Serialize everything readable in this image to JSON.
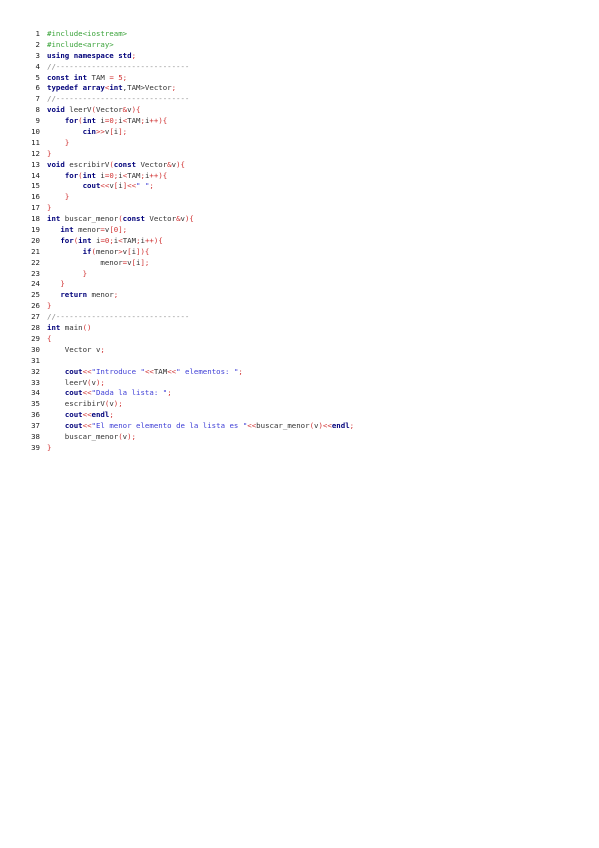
{
  "document": {
    "lines": [
      {
        "n": "1",
        "tokens": [
          {
            "t": "#include<iostream>",
            "c": "pp"
          }
        ]
      },
      {
        "n": "2",
        "tokens": [
          {
            "t": "#include<array>",
            "c": "pp"
          }
        ]
      },
      {
        "n": "3",
        "tokens": [
          {
            "t": "using",
            "c": "kw"
          },
          {
            "t": " ",
            "c": "tx"
          },
          {
            "t": "namespace",
            "c": "kw"
          },
          {
            "t": " ",
            "c": "tx"
          },
          {
            "t": "std",
            "c": "kw"
          },
          {
            "t": ";",
            "c": "pn"
          }
        ]
      },
      {
        "n": "4",
        "tokens": [
          {
            "t": "//------------------------------",
            "c": "cm"
          }
        ]
      },
      {
        "n": "5",
        "tokens": [
          {
            "t": "const",
            "c": "kw"
          },
          {
            "t": " ",
            "c": "tx"
          },
          {
            "t": "int",
            "c": "kw"
          },
          {
            "t": " TAM ",
            "c": "tx"
          },
          {
            "t": "=",
            "c": "pn"
          },
          {
            "t": " ",
            "c": "tx"
          },
          {
            "t": "5",
            "c": "num"
          },
          {
            "t": ";",
            "c": "pn"
          }
        ]
      },
      {
        "n": "6",
        "tokens": [
          {
            "t": "typedef",
            "c": "kw"
          },
          {
            "t": " ",
            "c": "tx"
          },
          {
            "t": "array",
            "c": "kw"
          },
          {
            "t": "<",
            "c": "pn"
          },
          {
            "t": "int",
            "c": "kw"
          },
          {
            "t": ",TAM>Vector",
            "c": "tx"
          },
          {
            "t": ";",
            "c": "pn"
          }
        ]
      },
      {
        "n": "7",
        "tokens": [
          {
            "t": "//------------------------------",
            "c": "cm"
          }
        ]
      },
      {
        "n": "8",
        "tokens": [
          {
            "t": "void",
            "c": "kw"
          },
          {
            "t": " leerV",
            "c": "tx"
          },
          {
            "t": "(",
            "c": "pn"
          },
          {
            "t": "Vector",
            "c": "tx"
          },
          {
            "t": "&",
            "c": "pn"
          },
          {
            "t": "v",
            "c": "tx"
          },
          {
            "t": "){",
            "c": "pn"
          }
        ]
      },
      {
        "n": "9",
        "tokens": [
          {
            "t": "    ",
            "c": "tx"
          },
          {
            "t": "for",
            "c": "kw"
          },
          {
            "t": "(",
            "c": "pn"
          },
          {
            "t": "int",
            "c": "kw"
          },
          {
            "t": " i",
            "c": "tx"
          },
          {
            "t": "=",
            "c": "pn"
          },
          {
            "t": "0",
            "c": "num"
          },
          {
            "t": ";",
            "c": "pn"
          },
          {
            "t": "i",
            "c": "tx"
          },
          {
            "t": "<",
            "c": "pn"
          },
          {
            "t": "TAM",
            "c": "tx"
          },
          {
            "t": ";",
            "c": "pn"
          },
          {
            "t": "i",
            "c": "tx"
          },
          {
            "t": "++){",
            "c": "pn"
          }
        ]
      },
      {
        "n": "10",
        "tokens": [
          {
            "t": "        ",
            "c": "tx"
          },
          {
            "t": "cin",
            "c": "kw"
          },
          {
            "t": ">>",
            "c": "pn"
          },
          {
            "t": "v",
            "c": "tx"
          },
          {
            "t": "[",
            "c": "pn"
          },
          {
            "t": "i",
            "c": "tx"
          },
          {
            "t": "];",
            "c": "pn"
          }
        ]
      },
      {
        "n": "11",
        "tokens": [
          {
            "t": "    ",
            "c": "tx"
          },
          {
            "t": "}",
            "c": "pn"
          }
        ]
      },
      {
        "n": "12",
        "tokens": [
          {
            "t": "}",
            "c": "pn"
          }
        ]
      },
      {
        "n": "13",
        "tokens": [
          {
            "t": "void",
            "c": "kw"
          },
          {
            "t": " escribirV",
            "c": "tx"
          },
          {
            "t": "(",
            "c": "pn"
          },
          {
            "t": "const",
            "c": "kw"
          },
          {
            "t": " Vector",
            "c": "tx"
          },
          {
            "t": "&",
            "c": "pn"
          },
          {
            "t": "v",
            "c": "tx"
          },
          {
            "t": "){",
            "c": "pn"
          }
        ]
      },
      {
        "n": "14",
        "tokens": [
          {
            "t": "    ",
            "c": "tx"
          },
          {
            "t": "for",
            "c": "kw"
          },
          {
            "t": "(",
            "c": "pn"
          },
          {
            "t": "int",
            "c": "kw"
          },
          {
            "t": " i",
            "c": "tx"
          },
          {
            "t": "=",
            "c": "pn"
          },
          {
            "t": "0",
            "c": "num"
          },
          {
            "t": ";",
            "c": "pn"
          },
          {
            "t": "i",
            "c": "tx"
          },
          {
            "t": "<",
            "c": "pn"
          },
          {
            "t": "TAM",
            "c": "tx"
          },
          {
            "t": ";",
            "c": "pn"
          },
          {
            "t": "i",
            "c": "tx"
          },
          {
            "t": "++){",
            "c": "pn"
          }
        ]
      },
      {
        "n": "15",
        "tokens": [
          {
            "t": "        ",
            "c": "tx"
          },
          {
            "t": "cout",
            "c": "kw"
          },
          {
            "t": "<<",
            "c": "pn"
          },
          {
            "t": "v",
            "c": "tx"
          },
          {
            "t": "[",
            "c": "pn"
          },
          {
            "t": "i",
            "c": "tx"
          },
          {
            "t": "]<<",
            "c": "pn"
          },
          {
            "t": "\" \"",
            "c": "str"
          },
          {
            "t": ";",
            "c": "pn"
          }
        ]
      },
      {
        "n": "16",
        "tokens": [
          {
            "t": "    ",
            "c": "tx"
          },
          {
            "t": "}",
            "c": "pn"
          }
        ]
      },
      {
        "n": "17",
        "tokens": [
          {
            "t": "}",
            "c": "pn"
          }
        ]
      },
      {
        "n": "18",
        "tokens": [
          {
            "t": "int",
            "c": "kw"
          },
          {
            "t": " buscar_menor",
            "c": "tx"
          },
          {
            "t": "(",
            "c": "pn"
          },
          {
            "t": "const",
            "c": "kw"
          },
          {
            "t": " Vector",
            "c": "tx"
          },
          {
            "t": "&",
            "c": "pn"
          },
          {
            "t": "v",
            "c": "tx"
          },
          {
            "t": "){",
            "c": "pn"
          }
        ]
      },
      {
        "n": "19",
        "tokens": [
          {
            "t": "   ",
            "c": "tx"
          },
          {
            "t": "int",
            "c": "kw"
          },
          {
            "t": " menor",
            "c": "tx"
          },
          {
            "t": "=",
            "c": "pn"
          },
          {
            "t": "v",
            "c": "tx"
          },
          {
            "t": "[",
            "c": "pn"
          },
          {
            "t": "0",
            "c": "num"
          },
          {
            "t": "];",
            "c": "pn"
          }
        ]
      },
      {
        "n": "20",
        "tokens": [
          {
            "t": "   ",
            "c": "tx"
          },
          {
            "t": "for",
            "c": "kw"
          },
          {
            "t": "(",
            "c": "pn"
          },
          {
            "t": "int",
            "c": "kw"
          },
          {
            "t": " i",
            "c": "tx"
          },
          {
            "t": "=",
            "c": "pn"
          },
          {
            "t": "0",
            "c": "num"
          },
          {
            "t": ";",
            "c": "pn"
          },
          {
            "t": "i",
            "c": "tx"
          },
          {
            "t": "<",
            "c": "pn"
          },
          {
            "t": "TAM",
            "c": "tx"
          },
          {
            "t": ";",
            "c": "pn"
          },
          {
            "t": "i",
            "c": "tx"
          },
          {
            "t": "++){",
            "c": "pn"
          }
        ]
      },
      {
        "n": "21",
        "tokens": [
          {
            "t": "        ",
            "c": "tx"
          },
          {
            "t": "if",
            "c": "kw"
          },
          {
            "t": "(",
            "c": "pn"
          },
          {
            "t": "menor",
            "c": "tx"
          },
          {
            "t": ">",
            "c": "pn"
          },
          {
            "t": "v",
            "c": "tx"
          },
          {
            "t": "[",
            "c": "pn"
          },
          {
            "t": "i",
            "c": "tx"
          },
          {
            "t": "]){",
            "c": "pn"
          }
        ]
      },
      {
        "n": "22",
        "tokens": [
          {
            "t": "            menor",
            "c": "tx"
          },
          {
            "t": "=",
            "c": "pn"
          },
          {
            "t": "v",
            "c": "tx"
          },
          {
            "t": "[",
            "c": "pn"
          },
          {
            "t": "i",
            "c": "tx"
          },
          {
            "t": "];",
            "c": "pn"
          }
        ]
      },
      {
        "n": "23",
        "tokens": [
          {
            "t": "        ",
            "c": "tx"
          },
          {
            "t": "}",
            "c": "pn"
          }
        ]
      },
      {
        "n": "24",
        "tokens": [
          {
            "t": "   ",
            "c": "tx"
          },
          {
            "t": "}",
            "c": "pn"
          }
        ]
      },
      {
        "n": "25",
        "tokens": [
          {
            "t": "   ",
            "c": "tx"
          },
          {
            "t": "return",
            "c": "kw"
          },
          {
            "t": " menor",
            "c": "tx"
          },
          {
            "t": ";",
            "c": "pn"
          }
        ]
      },
      {
        "n": "26",
        "tokens": [
          {
            "t": "}",
            "c": "pn"
          }
        ]
      },
      {
        "n": "27",
        "tokens": [
          {
            "t": "//------------------------------",
            "c": "cm"
          }
        ]
      },
      {
        "n": "28",
        "tokens": [
          {
            "t": "int",
            "c": "kw"
          },
          {
            "t": " main",
            "c": "tx"
          },
          {
            "t": "()",
            "c": "pn"
          }
        ]
      },
      {
        "n": "29",
        "tokens": [
          {
            "t": "{",
            "c": "pn"
          }
        ]
      },
      {
        "n": "30",
        "tokens": [
          {
            "t": "    Vector v",
            "c": "tx"
          },
          {
            "t": ";",
            "c": "pn"
          }
        ]
      },
      {
        "n": "31",
        "tokens": []
      },
      {
        "n": "32",
        "tokens": [
          {
            "t": "    ",
            "c": "tx"
          },
          {
            "t": "cout",
            "c": "kw"
          },
          {
            "t": "<<",
            "c": "pn"
          },
          {
            "t": "\"Introduce \"",
            "c": "str"
          },
          {
            "t": "<<",
            "c": "pn"
          },
          {
            "t": "TAM",
            "c": "tx"
          },
          {
            "t": "<<",
            "c": "pn"
          },
          {
            "t": "\" elementos: \"",
            "c": "str"
          },
          {
            "t": ";",
            "c": "pn"
          }
        ]
      },
      {
        "n": "33",
        "tokens": [
          {
            "t": "    leerV",
            "c": "tx"
          },
          {
            "t": "(",
            "c": "pn"
          },
          {
            "t": "v",
            "c": "tx"
          },
          {
            "t": ");",
            "c": "pn"
          }
        ]
      },
      {
        "n": "34",
        "tokens": [
          {
            "t": "    ",
            "c": "tx"
          },
          {
            "t": "cout",
            "c": "kw"
          },
          {
            "t": "<<",
            "c": "pn"
          },
          {
            "t": "\"Dada la lista: \"",
            "c": "str"
          },
          {
            "t": ";",
            "c": "pn"
          }
        ]
      },
      {
        "n": "35",
        "tokens": [
          {
            "t": "    escribirV",
            "c": "tx"
          },
          {
            "t": "(",
            "c": "pn"
          },
          {
            "t": "v",
            "c": "tx"
          },
          {
            "t": ");",
            "c": "pn"
          }
        ]
      },
      {
        "n": "36",
        "tokens": [
          {
            "t": "    ",
            "c": "tx"
          },
          {
            "t": "cout",
            "c": "kw"
          },
          {
            "t": "<<",
            "c": "pn"
          },
          {
            "t": "endl",
            "c": "kw"
          },
          {
            "t": ";",
            "c": "pn"
          }
        ]
      },
      {
        "n": "37",
        "tokens": [
          {
            "t": "    ",
            "c": "tx"
          },
          {
            "t": "cout",
            "c": "kw"
          },
          {
            "t": "<<",
            "c": "pn"
          },
          {
            "t": "\"El menor elemento de la lista es \"",
            "c": "str"
          },
          {
            "t": "<<",
            "c": "pn"
          },
          {
            "t": "buscar_menor",
            "c": "tx"
          },
          {
            "t": "(",
            "c": "pn"
          },
          {
            "t": "v",
            "c": "tx"
          },
          {
            "t": ")<<",
            "c": "pn"
          },
          {
            "t": "endl",
            "c": "kw"
          },
          {
            "t": ";",
            "c": "pn"
          }
        ]
      },
      {
        "n": "38",
        "tokens": [
          {
            "t": "    buscar_menor",
            "c": "tx"
          },
          {
            "t": "(",
            "c": "pn"
          },
          {
            "t": "v",
            "c": "tx"
          },
          {
            "t": ");",
            "c": "pn"
          }
        ]
      },
      {
        "n": "39",
        "tokens": [
          {
            "t": "}",
            "c": "pn"
          }
        ]
      }
    ]
  },
  "colors": {
    "keyword": "#00007a",
    "preprocessor": "#3aa33a",
    "comment": "#8a8a8a",
    "string": "#3f3fd6",
    "number": "#d03030",
    "punctuation": "#d03030",
    "text": "#333333"
  }
}
